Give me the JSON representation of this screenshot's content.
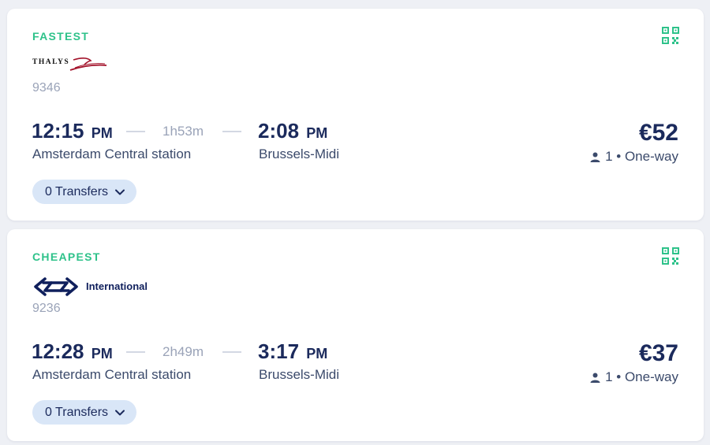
{
  "colors": {
    "accent_green": "#2ec28a",
    "navy_text": "#1b2a5c",
    "muted_gray": "#9aa3b8",
    "pill_bg": "#d9e6f7",
    "thalys_red": "#a3122a"
  },
  "cards": [
    {
      "tag": "FASTEST",
      "operator_logo": "thalys-logo",
      "operator_logo_text": "THALYS",
      "train_number": "9346",
      "departure": {
        "time": "12:15",
        "ampm": "PM",
        "station": "Amsterdam Central station"
      },
      "duration": "1h53m",
      "arrival": {
        "time": "2:08",
        "ampm": "PM",
        "station": "Brussels-Midi"
      },
      "price": "€52",
      "passengers": "1 • One-way",
      "transfers_label": "0 Transfers",
      "icons": [
        "qr-code-icon",
        "person-icon",
        "chevron-down-icon"
      ]
    },
    {
      "tag": "CHEAPEST",
      "operator_logo": "ns-logo",
      "operator_label": "International",
      "train_number": "9236",
      "departure": {
        "time": "12:28",
        "ampm": "PM",
        "station": "Amsterdam Central station"
      },
      "duration": "2h49m",
      "arrival": {
        "time": "3:17",
        "ampm": "PM",
        "station": "Brussels-Midi"
      },
      "price": "€37",
      "passengers": "1 • One-way",
      "transfers_label": "0 Transfers",
      "icons": [
        "qr-code-icon",
        "person-icon",
        "chevron-down-icon"
      ]
    }
  ]
}
